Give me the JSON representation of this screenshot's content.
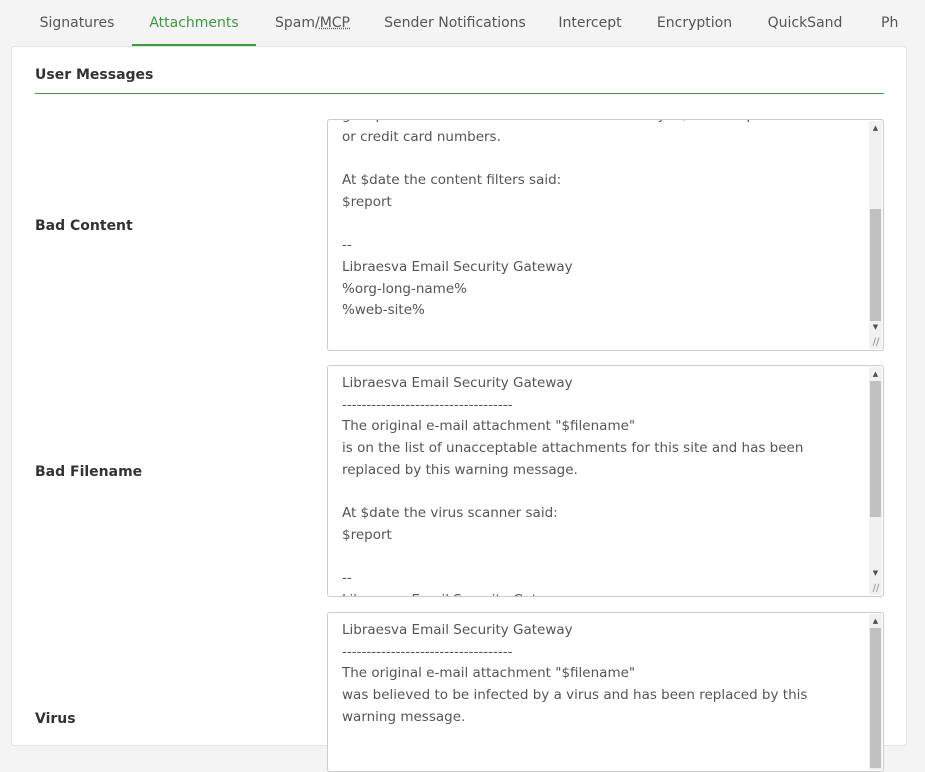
{
  "tabs": [
    {
      "label": "Signatures",
      "active": false
    },
    {
      "label": "Attachments",
      "active": true
    },
    {
      "label": "Spam/",
      "abbr": "MCP",
      "active": false
    },
    {
      "label": "Sender Notifications",
      "active": false
    },
    {
      "label": "Intercept",
      "active": false
    },
    {
      "label": "Encryption",
      "active": false
    },
    {
      "label": "QuickSand",
      "active": false
    },
    {
      "label": "Ph",
      "active": false
    }
  ],
  "section": {
    "title": "User Messages"
  },
  "colors": {
    "accent": "#3a9c3a",
    "text": "#333333",
    "muted": "#555555"
  },
  "messages": [
    {
      "label": "Bad Content",
      "text": "gain personal or confidential information from you, such as passwords\nor credit card numbers.\n\nAt $date the content filters said:\n$report\n\n--\nLibraesva Email Security Gateway\n%org-long-name%\n%web-site%"
    },
    {
      "label": "Bad Filename",
      "text": "Libraesva Email Security Gateway\n-----------------------------------\nThe original e-mail attachment \"$filename\"\nis on the list of unacceptable attachments for this site and has been\nreplaced by this warning message.\n\nAt $date the virus scanner said:\n$report\n\n--\nLibraesva Email Security Gateway"
    },
    {
      "label": "Virus",
      "text": "Libraesva Email Security Gateway\n-----------------------------------\nThe original e-mail attachment \"$filename\"\nwas believed to be infected by a virus and has been replaced by this\nwarning message."
    }
  ],
  "icons": {
    "scroll_up": "triangle-up",
    "scroll_down": "triangle-down",
    "resize": "resize-grip"
  }
}
